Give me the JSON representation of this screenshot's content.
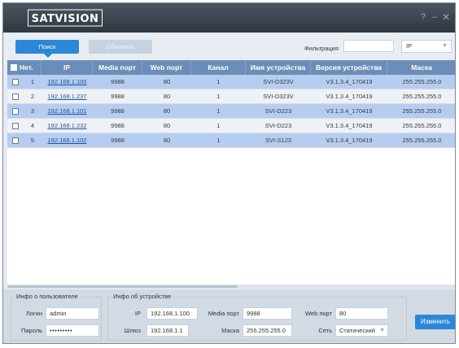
{
  "titlebar": {
    "logo_text": "SATVISION",
    "help": "?",
    "minimize": "–",
    "close": "✕"
  },
  "toolbar": {
    "search_label": "Поиск",
    "refresh_label": "Обновить",
    "filter_label": "Фильтрация",
    "filter_value": "",
    "filter_type": "IP"
  },
  "table": {
    "headers": [
      "Нет.",
      "IP",
      "Media порт",
      "Web порт",
      "Канал",
      "Имя устройства",
      "Версия устройства",
      "Маска"
    ],
    "rows": [
      {
        "no": "1",
        "ip": "192.168.1.100",
        "media_port": "9988",
        "web_port": "80",
        "channel": "1",
        "name": "SVI-D323V",
        "version": "V3.1.3.4_170419",
        "mask": "255.255.255.0",
        "highlighted": true
      },
      {
        "no": "2",
        "ip": "192.168.1.237",
        "media_port": "9988",
        "web_port": "80",
        "channel": "1",
        "name": "SVI-D323V",
        "version": "V3.1.3.4_170419",
        "mask": "255.255.255.0",
        "highlighted": false
      },
      {
        "no": "3",
        "ip": "192.168.1.101",
        "media_port": "9988",
        "web_port": "80",
        "channel": "1",
        "name": "SVI-D223",
        "version": "V3.1.3.4_170419",
        "mask": "255.255.255.0",
        "highlighted": true
      },
      {
        "no": "4",
        "ip": "192.168.1.232",
        "media_port": "9988",
        "web_port": "80",
        "channel": "1",
        "name": "SVI-D223",
        "version": "V3.1.3.4_170419",
        "mask": "255.255.255.0",
        "highlighted": false
      },
      {
        "no": "5",
        "ip": "192.168.1.102",
        "media_port": "9988",
        "web_port": "80",
        "channel": "1",
        "name": "SVI-S123",
        "version": "V3.1.3.4_170419",
        "mask": "255.255.255.0",
        "highlighted": true
      }
    ]
  },
  "user_info": {
    "legend": "Инфо о пользователе",
    "login_label": "Логин",
    "login_value": "admin",
    "password_label": "Пароль",
    "password_value": "•••••••••"
  },
  "device_info": {
    "legend": "Инфо об устройстве",
    "ip_label": "IP",
    "ip_value": "192.168.1.100",
    "media_port_label": "Media порт",
    "media_port_value": "9988",
    "web_port_label": "Web порт",
    "web_port_value": "80",
    "gateway_label": "Шлюз",
    "gateway_value": "192.168.1.1",
    "mask_label": "Маска",
    "mask_value": "255.255.255.0",
    "network_label": "Сеть",
    "network_value": "Статический"
  },
  "actions": {
    "change_label": "Изменить"
  },
  "colors": {
    "accent": "#2d87d8",
    "header": "#6b8db8",
    "row_highlight": "#b5cdf0",
    "titlebar": "#3a434d"
  }
}
